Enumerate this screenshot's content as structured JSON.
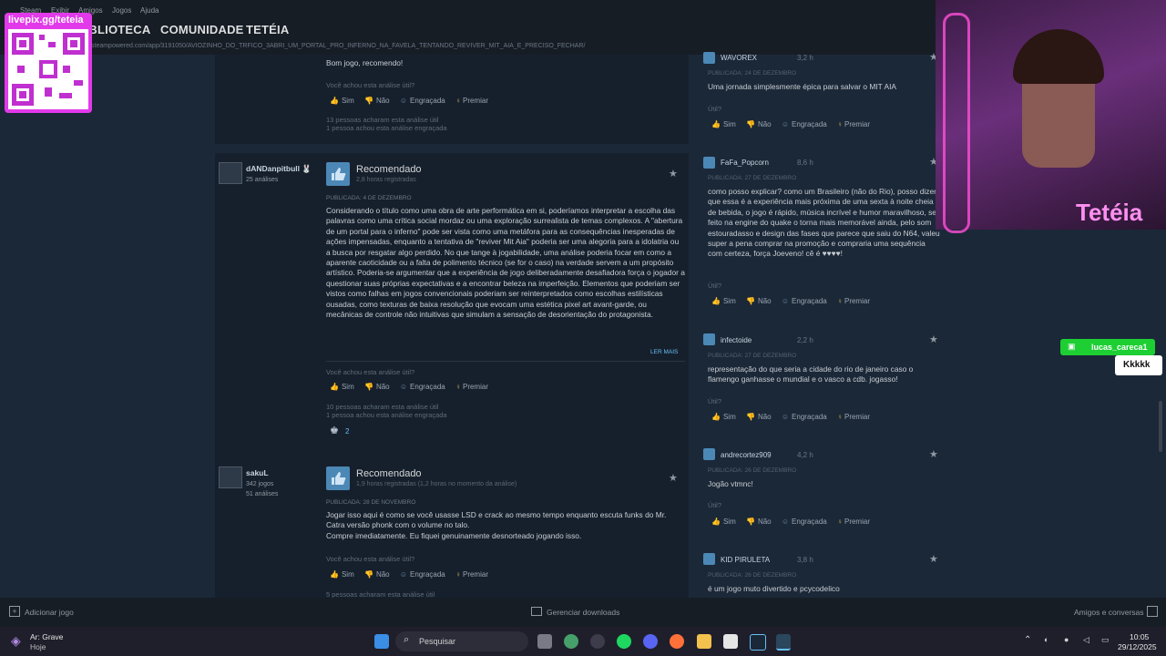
{
  "menu": [
    "Steam",
    "Exibir",
    "Amigos",
    "Jogos",
    "Ajuda"
  ],
  "nav": [
    "BIBLIOTECA",
    "COMUNIDADE",
    "TETÉIA"
  ],
  "url": "steampowered.com/app/3191050/AVIOZINHO_DO_TRFICO_3ABRI_UM_PORTAL_PRO_INFERNO_NA_FAVELA_TENTANDO_REVIVER_MIT_AIA_E_PRECISO_FECHAR/",
  "vote_labels": {
    "sim": "Sim",
    "nao": "Não",
    "engracada": "Engraçada",
    "premiar": "Premiar"
  },
  "helpful_q": "Você achou esta análise útil?",
  "util_q": "Útil?",
  "read_more": "LER MAIS",
  "recommended": "Recomendado",
  "review0": {
    "text": "Bom jogo, recomendo!",
    "stat1": "13 pessoas acharam esta análise útil",
    "stat2": "1 pessoa achou esta análise engraçada"
  },
  "review1": {
    "user": "dANDanpitbull 🐰",
    "meta": "25 análises",
    "hours": "2,8 horas registradas",
    "published": "PUBLICADA: 4 DE DEZEMBRO",
    "text": "Considerando o título como uma obra de arte performática em si, poderíamos interpretar a escolha das palavras como uma crítica social mordaz ou uma exploração surrealista de temas complexos. A \"abertura de um portal para o inferno\" pode ser vista como uma metáfora para as consequências inesperadas de ações impensadas, enquanto a tentativa de \"reviver Mit Aia\" poderia ser uma alegoria para a idolatria ou a busca por resgatar algo perdido. No que tange à jogabilidade, uma análise poderia focar em como a aparente caoticidade ou a falta de polimento técnico (se for o caso) na verdade servem a um propósito artístico. Poderia-se argumentar que a experiência de jogo deliberadamente desafiadora força o jogador a questionar suas próprias expectativas e a encontrar beleza na imperfeição. Elementos que poderiam ser vistos como falhas em jogos convencionais poderiam ser reinterpretados como escolhas estilísticas ousadas, como texturas de baixa resolução que evocam uma estética pixel art avant-garde, ou mecânicas de controle não intuitivas que simulam a sensação de desorientação do protagonista.",
    "stat1": "10 pessoas acharam esta análise útil",
    "stat2": "1 pessoa achou esta análise engraçada",
    "award_count": "2"
  },
  "review2": {
    "user": "sakuL",
    "meta1": "342 jogos",
    "meta2": "51 análises",
    "hours": "1,9 horas registradas (1,2 horas no momento da análise)",
    "published": "PUBLICADA: 28 DE NOVEMBRO",
    "line1": "Jogar isso aqui é como se você usasse LSD e crack ao mesmo tempo enquanto escuta funks do Mr. Catra versão phonk com o volume no talo.",
    "line2": "Compre imediatamente. Eu fiquei genuinamente desnorteado jogando isso.",
    "stat1": "5 pessoas acharam esta análise útil"
  },
  "side_reviews": [
    {
      "user": "WAVOREX",
      "hours": "3,2 h",
      "published": "PUBLICADA: 24 DE DEZEMBRO",
      "text": "Uma jornada simplesmente épica para salvar o MIT AIA"
    },
    {
      "user": "FaFa_Popcorn",
      "hours": "8,6 h",
      "published": "PUBLICADA: 27 DE DEZEMBRO",
      "text": "como posso explicar? como um Brasileiro (não do Rio), posso dizer que essa é a experiência mais próxima de uma sexta à noite cheia de bebida, o jogo é rápido, música incrível e humor maravilhoso, ser feito na engine do quake o torna mais memorável ainda, pelo som estouradasso e design das fases que parece que saiu do N64, valeu super a pena comprar na promoção e compraria uma sequência com certeza, força Joeveno! cê é ♥♥♥♥!"
    },
    {
      "user": "infectoide",
      "hours": "2,2 h",
      "published": "PUBLICADA: 27 DE DEZEMBRO",
      "text": "representação do que seria a cidade do rio de janeiro caso o flamengo ganhasse o mundial e o vasco a cdb. jogasso!"
    },
    {
      "user": "andrecortez909",
      "hours": "4,2 h",
      "published": "PUBLICADA: 26 DE DEZEMBRO",
      "text": "Jogão vtmnc!"
    },
    {
      "user": "KID PIRULETA",
      "hours": "3,8 h",
      "published": "PUBLICADA: 26 DE DEZEMBRO",
      "text": "é um jogo muto divertido e pcycodelico"
    }
  ],
  "bottom": {
    "add": "Adicionar jogo",
    "downloads": "Gerenciar downloads",
    "friends": "Amigos e conversas"
  },
  "overlay": {
    "qr_text": "livepix.gg/teteia",
    "streamer": "Tetéia",
    "chat_user": "lucas_careca1",
    "chat_msg": "Kkkkk"
  },
  "taskbar": {
    "weather1": "Ar: Grave",
    "weather2": "Hoje",
    "search": "Pesquisar",
    "time": "10:05",
    "date": "29/12/2025"
  },
  "colors": {
    "accent": "#66c0f4",
    "award": "#d2ad48",
    "chat": "#1dcf33",
    "overlay_pink": "#e239ea"
  }
}
